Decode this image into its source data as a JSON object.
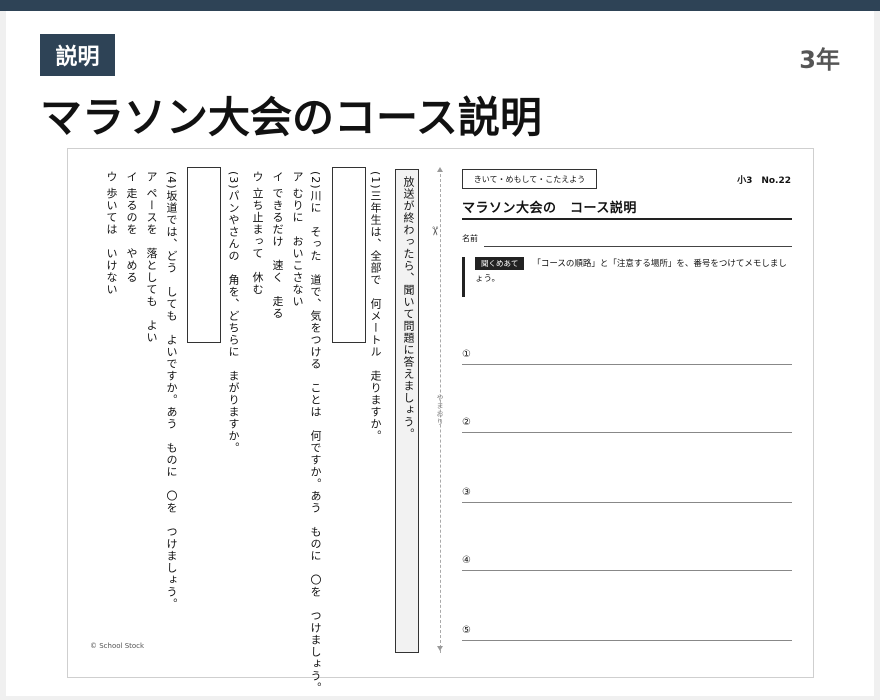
{
  "header": {
    "badge": "説明",
    "grade": "3年",
    "title": "マラソン大会のコース説明"
  },
  "worksheet": {
    "instruction": "放送が終わったら、聞いて問題に答えましょう。",
    "q1": "(1)三年生は、全部で　何メートル　走りますか。",
    "q2_stem": "(2)川に　そった　道で、気をつける　ことは　何ですか。あう　ものに　〇を　つけましょう。",
    "q2_options": [
      "ア むりに　おいこさない",
      "イ できるだけ　速く　走る",
      "ウ 立ち止まって　休む"
    ],
    "q3": "(3)パンやさんの　角を、どちらに　まがりますか。",
    "q4_stem": "(4)坂道では、どう　しても　よいですか。あう　ものに　〇を　つけましょう。",
    "q4_options": [
      "ア ペースを　落としても　よい",
      "イ 走るのを　やめる",
      "ウ 歩いては　いけない"
    ],
    "copyright": "© School Stock",
    "fold_label": "やまおり",
    "scissors_icon": "✂",
    "tag": "きいて・めもして・こたえよう",
    "sheet_number": "小3　No.22",
    "sheet_title": "マラソン大会の　コース説明",
    "name_label": "名前",
    "chip": "聞くめあて",
    "instruction_text": "「コースの順路」と「注意する場所」を、番号をつけてメモしましょう。",
    "answers": [
      "①",
      "②",
      "③",
      "④",
      "⑤"
    ]
  },
  "colors": {
    "accent": "#2e4356",
    "grade_text": "#555555"
  }
}
